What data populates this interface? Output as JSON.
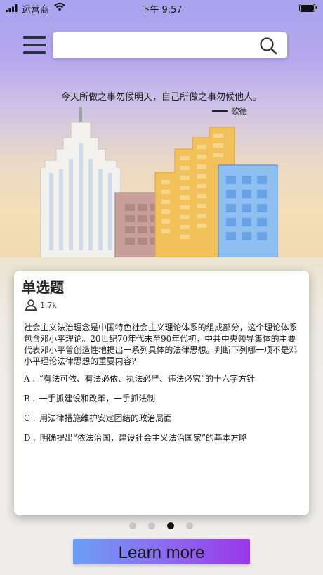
{
  "status_bar": {
    "carrier": "运营商",
    "time": "下午 9:57",
    "icons": [
      "signal-icon",
      "wifi-icon",
      "battery-icon"
    ]
  },
  "header": {
    "menu_icon": "hamburger-menu-icon",
    "search": {
      "value": "",
      "placeholder": "",
      "icon": "search-icon"
    }
  },
  "hero": {
    "quote": "今天所做之事勿候明天，自己所做之事勿候他人。",
    "author": "歌德"
  },
  "card": {
    "title": "单选题",
    "views": "1.7k",
    "user_icon": "user-icon",
    "question": "社会主义法治理念是中国特色社会主义理论体系的组成部分，这个理论体系包含邓小平理论。20世纪70年代末至90年代初，中共中央领导集体的主要代表邓小平曾创造性地提出一系列具体的法律思想。判断下列哪一项不是邓小平理论法律思想的重要内容?",
    "options": [
      {
        "letter": "A .",
        "text": "“有法可依、有法必依、执法必严、违法必究”的十六字方针"
      },
      {
        "letter": "B .",
        "text": "一手抓建设和改革，一手抓法制"
      },
      {
        "letter": "C .",
        "text": "用法律措施维护安定团结的政治局面"
      },
      {
        "letter": "D .",
        "text": "明确提出“依法治国，建设社会主义法治国家”的基本方略"
      }
    ]
  },
  "pager": {
    "count": 4,
    "active_index": 2
  },
  "cta": {
    "label": "Learn more"
  },
  "colors": {
    "accent_gradient": [
      "#6d9ff4",
      "#9a37ea"
    ],
    "card_background": "#ffffff",
    "hero_top": "#a7a3ef",
    "hero_bottom": "#f0d9b0"
  }
}
